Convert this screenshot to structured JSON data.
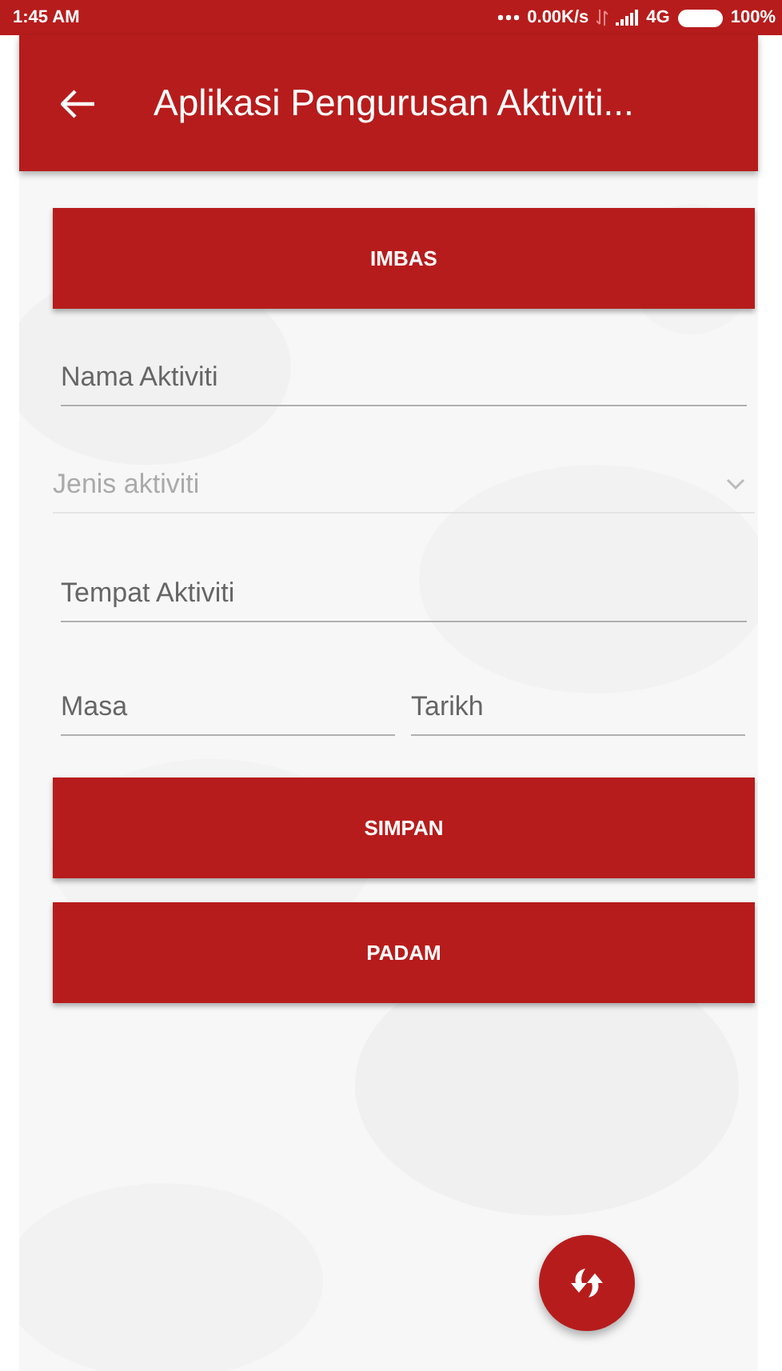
{
  "status_bar": {
    "time": "1:45 AM",
    "network_speed": "0.00K/s",
    "network_type": "4G",
    "battery": "100%"
  },
  "app_bar": {
    "title": "Aplikasi Pengurusan Aktiviti..."
  },
  "scan_button": {
    "label": "IMBAS"
  },
  "fields": [
    {
      "kind": "text",
      "placeholder": "Nama Aktiviti"
    },
    {
      "kind": "dropdown",
      "placeholder": "Jenis aktiviti"
    },
    {
      "kind": "text",
      "placeholder": "Tempat Aktiviti"
    }
  ],
  "row_fields": [
    {
      "placeholder": "Masa"
    },
    {
      "placeholder": "Tarikh"
    }
  ],
  "buttons": [
    {
      "label": "SIMPAN"
    },
    {
      "label": "PADAM"
    }
  ]
}
